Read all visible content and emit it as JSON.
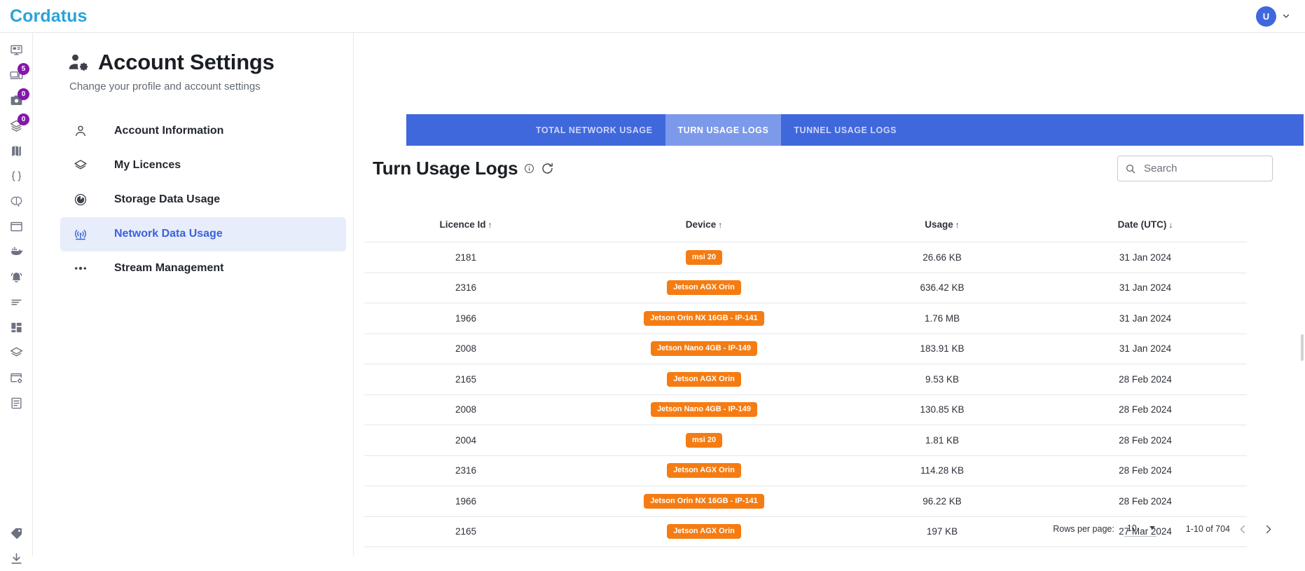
{
  "topbar": {
    "brand": "Cordatus",
    "avatar_initial": "U",
    "avatar_color": "#4068dd",
    "chevron_icon": "chevron-down-icon"
  },
  "rail": {
    "items": [
      {
        "icon": "monitor-desktop-icon",
        "badge": null
      },
      {
        "icon": "devices-icon",
        "badge": "5"
      },
      {
        "icon": "camera-icon",
        "badge": "0"
      },
      {
        "icon": "layers-icon",
        "badge": "0"
      },
      {
        "icon": "map-icon",
        "badge": null
      },
      {
        "icon": "code-braces-icon",
        "badge": null
      },
      {
        "icon": "brain-icon",
        "badge": null
      },
      {
        "icon": "window-icon",
        "badge": null
      },
      {
        "icon": "docker-icon",
        "badge": null
      },
      {
        "icon": "bell-icon",
        "badge": null
      },
      {
        "icon": "list-lines-icon",
        "badge": null
      },
      {
        "icon": "dashboard-grid-icon",
        "badge": null
      },
      {
        "icon": "stack-icon",
        "badge": null
      },
      {
        "icon": "window-settings-icon",
        "badge": null
      },
      {
        "icon": "document-icon",
        "badge": null
      }
    ],
    "bottom_items": [
      {
        "icon": "tag-icon",
        "badge": null
      },
      {
        "icon": "download-icon",
        "badge": null
      }
    ],
    "badge_color": "#8516ad"
  },
  "header": {
    "title": "Account Settings",
    "subtitle": "Change your profile and account settings",
    "icon": "account-settings-icon"
  },
  "settings_nav": {
    "items": [
      {
        "label": "Account Information",
        "icon": "person-icon",
        "active": false
      },
      {
        "label": "My Licences",
        "icon": "layers-icon",
        "active": false
      },
      {
        "label": "Storage Data Usage",
        "icon": "gauge-icon",
        "active": false
      },
      {
        "label": "Network Data Usage",
        "icon": "signal-broadcast-icon",
        "active": true
      },
      {
        "label": "Stream Management",
        "icon": "stream-icon",
        "active": false
      }
    ],
    "active_bg": "#e8edfb",
    "active_color": "#3b63db"
  },
  "tabs": {
    "accent": "#4068dd",
    "active_bg": "#7d99ea",
    "items": [
      {
        "label": "TOTAL NETWORK USAGE",
        "active": false
      },
      {
        "label": "TURN USAGE LOGS",
        "active": true
      },
      {
        "label": "TUNNEL USAGE LOGS",
        "active": false
      }
    ]
  },
  "panel": {
    "title": "Turn Usage Logs",
    "info_icon": "info-circle-icon",
    "refresh_icon": "refresh-icon"
  },
  "search": {
    "placeholder": "Search",
    "value": "",
    "icon": "search-icon"
  },
  "table": {
    "columns": [
      {
        "label": "Licence Id",
        "sort": "↑"
      },
      {
        "label": "Device",
        "sort": "↑"
      },
      {
        "label": "Usage",
        "sort": "↑"
      },
      {
        "label": "Date (UTC)",
        "sort": "↓"
      }
    ],
    "chip_color": "#f57c12",
    "rows": [
      {
        "licence_id": "2181",
        "device": "msi 20",
        "usage": "26.66 KB",
        "date": "31 Jan 2024"
      },
      {
        "licence_id": "2316",
        "device": "Jetson AGX Orin",
        "usage": "636.42 KB",
        "date": "31 Jan 2024"
      },
      {
        "licence_id": "1966",
        "device": "Jetson Orin NX 16GB - IP-141",
        "usage": "1.76 MB",
        "date": "31 Jan 2024"
      },
      {
        "licence_id": "2008",
        "device": "Jetson Nano 4GB - IP-149",
        "usage": "183.91 KB",
        "date": "31 Jan 2024"
      },
      {
        "licence_id": "2165",
        "device": "Jetson AGX Orin",
        "usage": "9.53 KB",
        "date": "28 Feb 2024"
      },
      {
        "licence_id": "2008",
        "device": "Jetson Nano 4GB - IP-149",
        "usage": "130.85 KB",
        "date": "28 Feb 2024"
      },
      {
        "licence_id": "2004",
        "device": "msi 20",
        "usage": "1.81 KB",
        "date": "28 Feb 2024"
      },
      {
        "licence_id": "2316",
        "device": "Jetson AGX Orin",
        "usage": "114.28 KB",
        "date": "28 Feb 2024"
      },
      {
        "licence_id": "1966",
        "device": "Jetson Orin NX 16GB - IP-141",
        "usage": "96.22 KB",
        "date": "28 Feb 2024"
      },
      {
        "licence_id": "2165",
        "device": "Jetson AGX Orin",
        "usage": "197 KB",
        "date": "27 Mar 2024"
      }
    ]
  },
  "pagination": {
    "rows_per_page_label": "Rows per page:",
    "rows_per_page_value": "10",
    "range_label": "1-10 of 704",
    "prev_icon": "chevron-left-icon",
    "next_icon": "chevron-right-icon"
  }
}
